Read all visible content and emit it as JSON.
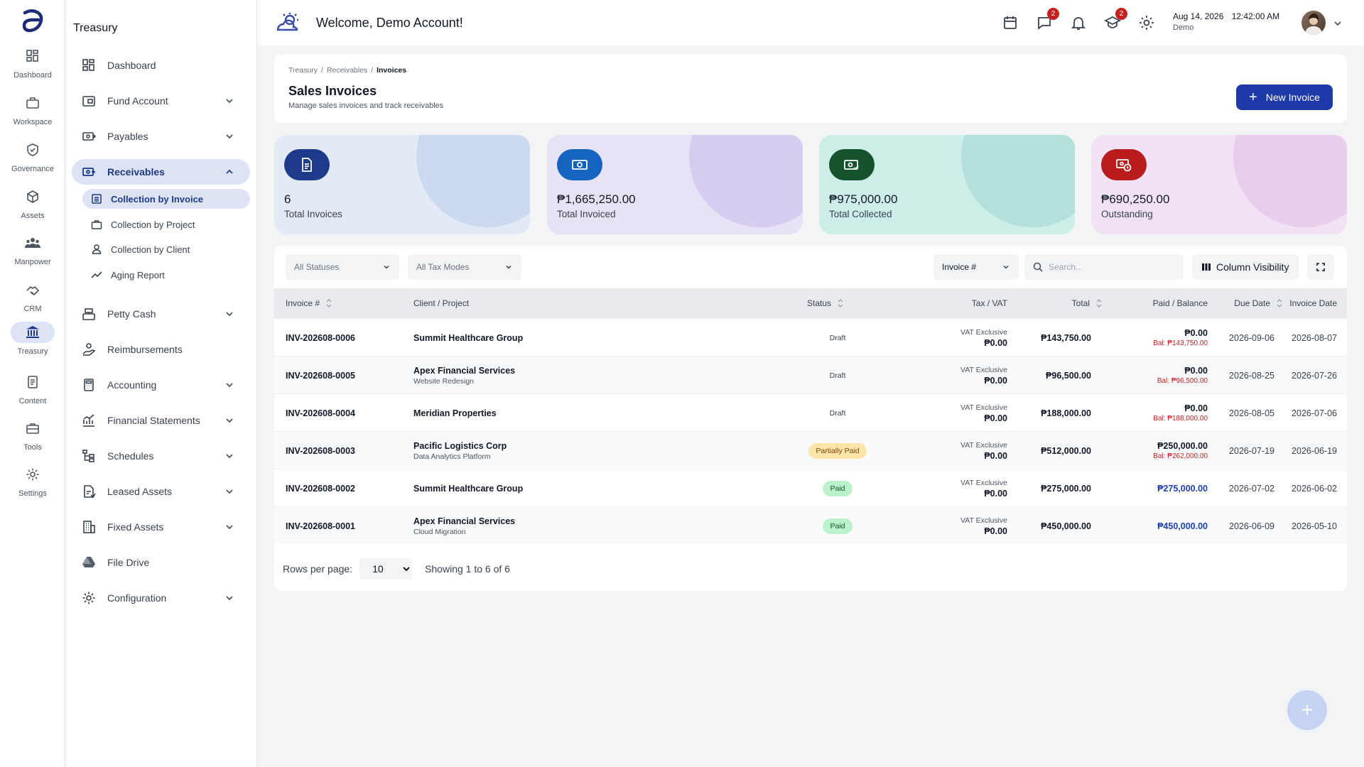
{
  "rail": {
    "items": [
      {
        "label": "Dashboard",
        "icon": "grid-icon"
      },
      {
        "label": "Workspace",
        "icon": "briefcase-icon"
      },
      {
        "label": "Governance",
        "icon": "shield-icon"
      },
      {
        "label": "Assets",
        "icon": "cube-icon"
      },
      {
        "label": "Manpower",
        "icon": "people-icon"
      },
      {
        "label": "CRM",
        "icon": "handshake-icon"
      },
      {
        "label": "Treasury",
        "icon": "bank-icon"
      },
      {
        "label": "Content",
        "icon": "document-icon"
      },
      {
        "label": "Tools",
        "icon": "toolbox-icon"
      },
      {
        "label": "Settings",
        "icon": "gear-icon"
      }
    ]
  },
  "sidebar": {
    "title": "Treasury",
    "items": [
      {
        "label": "Dashboard"
      },
      {
        "label": "Fund Account"
      },
      {
        "label": "Payables"
      },
      {
        "label": "Receivables"
      },
      {
        "label": "Petty Cash"
      },
      {
        "label": "Reimbursements"
      },
      {
        "label": "Accounting"
      },
      {
        "label": "Financial Statements"
      },
      {
        "label": "Schedules"
      },
      {
        "label": "Leased Assets"
      },
      {
        "label": "Fixed Assets"
      },
      {
        "label": "File Drive"
      },
      {
        "label": "Configuration"
      }
    ],
    "receivables_sub": [
      {
        "label": "Collection by Invoice"
      },
      {
        "label": "Collection by Project"
      },
      {
        "label": "Collection by Client"
      },
      {
        "label": "Aging Report"
      }
    ]
  },
  "header": {
    "welcome": "Welcome, Demo Account!",
    "messages_badge": "2",
    "learning_badge": "2",
    "date": "Aug 14, 2026",
    "time": "12:42:00 AM",
    "account": "Demo"
  },
  "page": {
    "breadcrumb": [
      "Treasury",
      "/",
      "Receivables",
      "/",
      "Invoices"
    ],
    "title": "Sales Invoices",
    "subtitle": "Manage sales invoices and track receivables",
    "new_button": "New Invoice"
  },
  "stats": [
    {
      "value": "6",
      "label": "Total Invoices",
      "color": "#1e3a8a"
    },
    {
      "value": "₱1,665,250.00",
      "label": "Total Invoiced",
      "color": "#1565c0"
    },
    {
      "value": "₱975,000.00",
      "label": "Total Collected",
      "color": "#14532d"
    },
    {
      "value": "₱690,250.00",
      "label": "Outstanding",
      "color": "#b91c1c"
    }
  ],
  "filters": {
    "status": "All Statuses",
    "tax_mode": "All Tax Modes",
    "search_field": "Invoice #",
    "search_placeholder": "Search...",
    "column_visibility": "Column Visibility"
  },
  "table": {
    "columns": [
      "Invoice #",
      "Client / Project",
      "Status",
      "Tax / VAT",
      "Total",
      "Paid / Balance",
      "Due Date",
      "Invoice Date"
    ],
    "rows": [
      {
        "invoice": "INV-202608-0006",
        "client": "Summit Healthcare Group",
        "project": "",
        "status": "Draft",
        "tax_mode": "VAT Exclusive",
        "tax": "₱0.00",
        "total": "₱143,750.00",
        "paid": "₱0.00",
        "balance": "Bal: ₱143,750.00",
        "due": "2026-09-06",
        "date": "2026-08-07"
      },
      {
        "invoice": "INV-202608-0005",
        "client": "Apex Financial Services",
        "project": "Website Redesign",
        "status": "Draft",
        "tax_mode": "VAT Exclusive",
        "tax": "₱0.00",
        "total": "₱96,500.00",
        "paid": "₱0.00",
        "balance": "Bal: ₱96,500.00",
        "due": "2026-08-25",
        "date": "2026-07-26"
      },
      {
        "invoice": "INV-202608-0004",
        "client": "Meridian Properties",
        "project": "",
        "status": "Draft",
        "tax_mode": "VAT Exclusive",
        "tax": "₱0.00",
        "total": "₱188,000.00",
        "paid": "₱0.00",
        "balance": "Bal: ₱188,000.00",
        "due": "2026-08-05",
        "date": "2026-07-06"
      },
      {
        "invoice": "INV-202608-0003",
        "client": "Pacific Logistics Corp",
        "project": "Data Analytics Platform",
        "status": "Partially Paid",
        "tax_mode": "VAT Exclusive",
        "tax": "₱0.00",
        "total": "₱512,000.00",
        "paid": "₱250,000.00",
        "balance": "Bal: ₱262,000.00",
        "due": "2026-07-19",
        "date": "2026-06-19"
      },
      {
        "invoice": "INV-202608-0002",
        "client": "Summit Healthcare Group",
        "project": "",
        "status": "Paid",
        "tax_mode": "VAT Exclusive",
        "tax": "₱0.00",
        "total": "₱275,000.00",
        "paid": "₱275,000.00",
        "balance": "",
        "due": "2026-07-02",
        "date": "2026-06-02"
      },
      {
        "invoice": "INV-202608-0001",
        "client": "Apex Financial Services",
        "project": "Cloud Migration",
        "status": "Paid",
        "tax_mode": "VAT Exclusive",
        "tax": "₱0.00",
        "total": "₱450,000.00",
        "paid": "₱450,000.00",
        "balance": "",
        "due": "2026-06-09",
        "date": "2026-05-10"
      }
    ]
  },
  "pagination": {
    "rows_label": "Rows per page:",
    "rows_value": "10",
    "rows_options": [
      "10"
    ],
    "showing": "Showing 1 to 6 of 6"
  }
}
